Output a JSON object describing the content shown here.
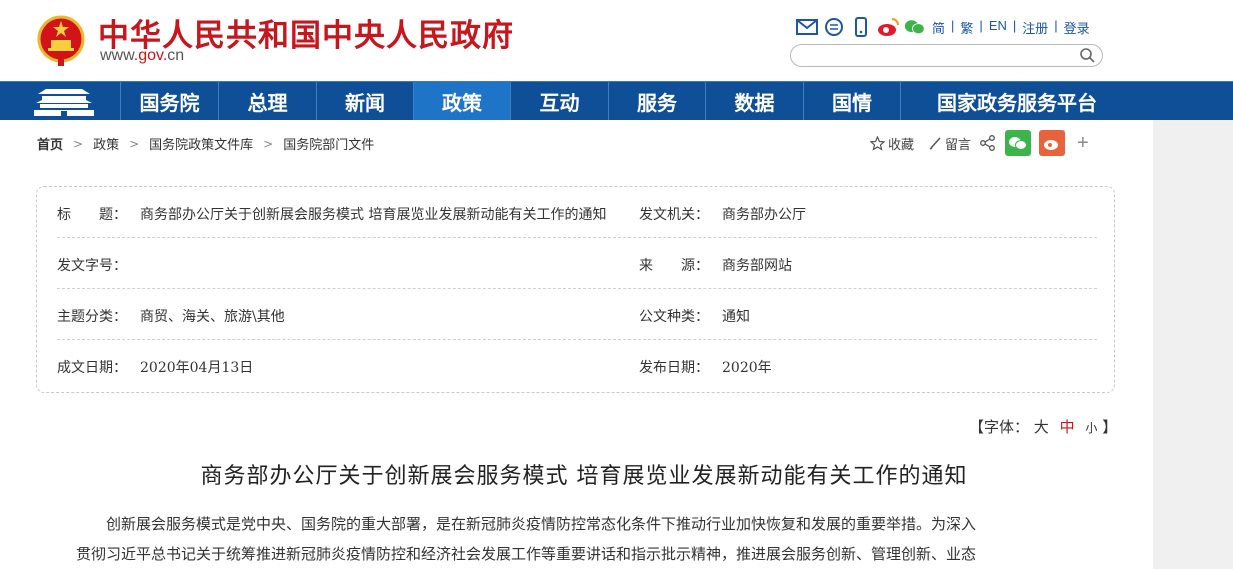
{
  "header": {
    "site_title": "中华人民共和国中央人民政府",
    "domain_prefix": "www",
    "domain_gov": "gov",
    "domain_suffix": "cn",
    "links": [
      "简",
      "繁",
      "EN",
      "注册",
      "登录"
    ],
    "search_placeholder": ""
  },
  "nav": {
    "items": [
      {
        "label": "国务院"
      },
      {
        "label": "总理"
      },
      {
        "label": "新闻"
      },
      {
        "label": "政策",
        "active": true
      },
      {
        "label": "互动"
      },
      {
        "label": "服务"
      },
      {
        "label": "数据"
      },
      {
        "label": "国情"
      },
      {
        "label": "国家政务服务平台"
      }
    ]
  },
  "breadcrumb": [
    "首页",
    "政策",
    "国务院政策文件库",
    "国务院部门文件"
  ],
  "share": {
    "favorite": "收藏",
    "comment": "留言"
  },
  "info": {
    "title_label": "标　　题：",
    "title_value": "商务部办公厅关于创新展会服务模式 培育展览业发展新动能有关工作的通知",
    "issuer_label": "发文机关：",
    "issuer_value": "商务部办公厅",
    "doc_no_label": "发文字号：",
    "doc_no_value": "",
    "source_label": "来　　源：",
    "source_value": "商务部网站",
    "topic_label": "主题分类：",
    "topic_value": "商贸、海关、旅游\\其他",
    "type_label": "公文种类：",
    "type_value": "通知",
    "written_label": "成文日期：",
    "written_value": "2020年04月13日",
    "published_label": "发布日期：",
    "published_value": "2020年"
  },
  "font_ctrl": {
    "open": "【字体：",
    "large": "大",
    "medium": "中",
    "small": "小",
    "close": "】"
  },
  "article": {
    "title": "商务部办公厅关于创新展会服务模式 培育展览业发展新动能有关工作的通知",
    "para1_line1": "创新展会服务模式是党中央、国务院的重大部署，是在新冠肺炎疫情防控常态化条件下推动行业加快恢复和发展的重要举措。为深入",
    "para1_line2": "贯彻习近平总书记关于统筹推进新冠肺炎疫情防控和经济社会发展工作等重要讲话和指示批示精神，推进展会服务创新、管理创新、业态"
  },
  "colors": {
    "brand_red": "#c8161d",
    "nav_blue": "#0f4f97",
    "nav_active": "#1e74c6",
    "link_blue": "#1c57a5",
    "wechat_green": "#3bb54a",
    "weibo_orange": "#e8623c"
  }
}
